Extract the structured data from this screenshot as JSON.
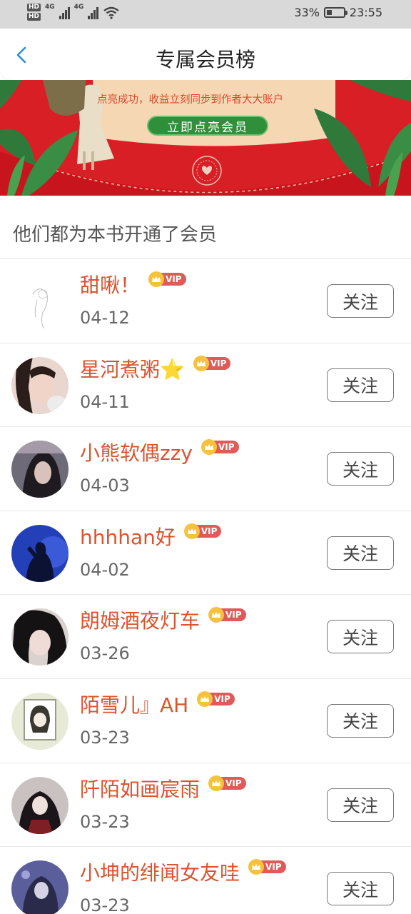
{
  "status_bar": {
    "hd1": "HD",
    "hd2": "HD",
    "net1": "4G",
    "net2": "4G",
    "battery_text": "33%",
    "battery_level": 0.33,
    "time": "23:55",
    "icons": [
      "signal-icon",
      "wifi-icon",
      "battery-icon"
    ]
  },
  "header": {
    "title": "专属会员榜",
    "back_icon": "chevron-left-icon"
  },
  "banner": {
    "text": "点亮成功，收益立刻同步到作者大大账户",
    "button_label": "立即点亮会员"
  },
  "section": {
    "title": "他们都为本书开通了会员"
  },
  "colors": {
    "name": "#d9542f",
    "vip_badge": "#e05a5a",
    "crown": "#f6c23e",
    "banner_red": "#d91f26",
    "banner_cream": "#f6d7b4",
    "button_green": "#2f8f3a"
  },
  "members": [
    {
      "name": "甜啾！",
      "date": "04-12",
      "vip": "VIP",
      "follow": "关注"
    },
    {
      "name": "星河煮粥⭐",
      "date": "04-11",
      "vip": "VIP",
      "follow": "关注"
    },
    {
      "name": "小熊软偶zzy",
      "date": "04-03",
      "vip": "VIP",
      "follow": "关注"
    },
    {
      "name": "hhhhan好",
      "date": "04-02",
      "vip": "VIP",
      "follow": "关注"
    },
    {
      "name": "朗姆酒夜灯车",
      "date": "03-26",
      "vip": "VIP",
      "follow": "关注"
    },
    {
      "name": "陌雪儿』AH",
      "date": "03-23",
      "vip": "VIP",
      "follow": "关注"
    },
    {
      "name": "阡陌如画宸雨",
      "date": "03-23",
      "vip": "VIP",
      "follow": "关注"
    },
    {
      "name": "小坤的绯闻女友哇",
      "date": "03-23",
      "vip": "VIP",
      "follow": "关注"
    }
  ]
}
